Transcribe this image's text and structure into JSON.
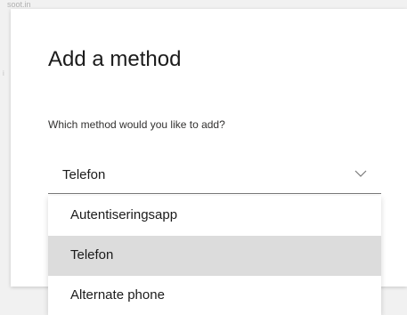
{
  "background": {
    "top_text": "soot.in",
    "side_mark": "i"
  },
  "dialog": {
    "title": "Add a method",
    "prompt": "Which method would you like to add?",
    "select": {
      "value": "Telefon",
      "chevron_icon": "chevron-down-icon",
      "chevron_color": "#7a7a7a"
    },
    "options": [
      {
        "label": "Autentiseringsapp",
        "selected": false
      },
      {
        "label": "Telefon",
        "selected": true
      },
      {
        "label": "Alternate phone",
        "selected": false
      }
    ]
  },
  "colors": {
    "selected_option_bg": "#dcdcdc",
    "text": "#1b1b1b",
    "page_bg": "#f1f1f1"
  }
}
